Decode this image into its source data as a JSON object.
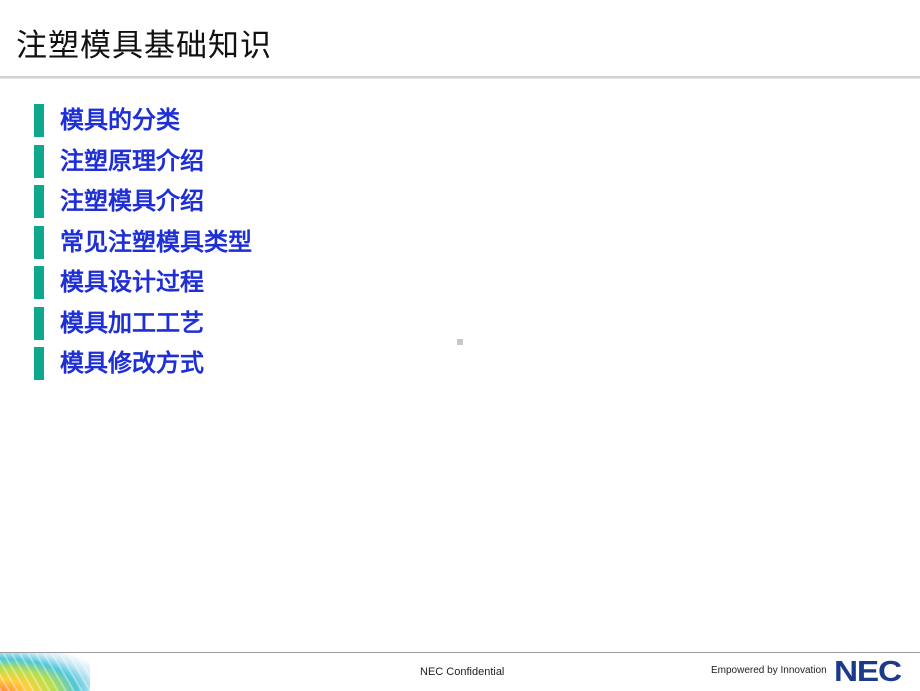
{
  "slide": {
    "title": "注塑模具基础知识",
    "items": [
      "模具的分类",
      "注塑原理介绍",
      "注塑模具介绍",
      "常见注塑模具类型",
      "模具设计过程",
      "模具加工工艺",
      "模具修改方式"
    ]
  },
  "footer": {
    "confidential": "NEC Confidential",
    "tagline": "Empowered by Innovation",
    "logo": "NEC"
  },
  "colors": {
    "bullet": "#10a88c",
    "item_text": "#1f2fd6",
    "logo": "#1b3a8a"
  }
}
